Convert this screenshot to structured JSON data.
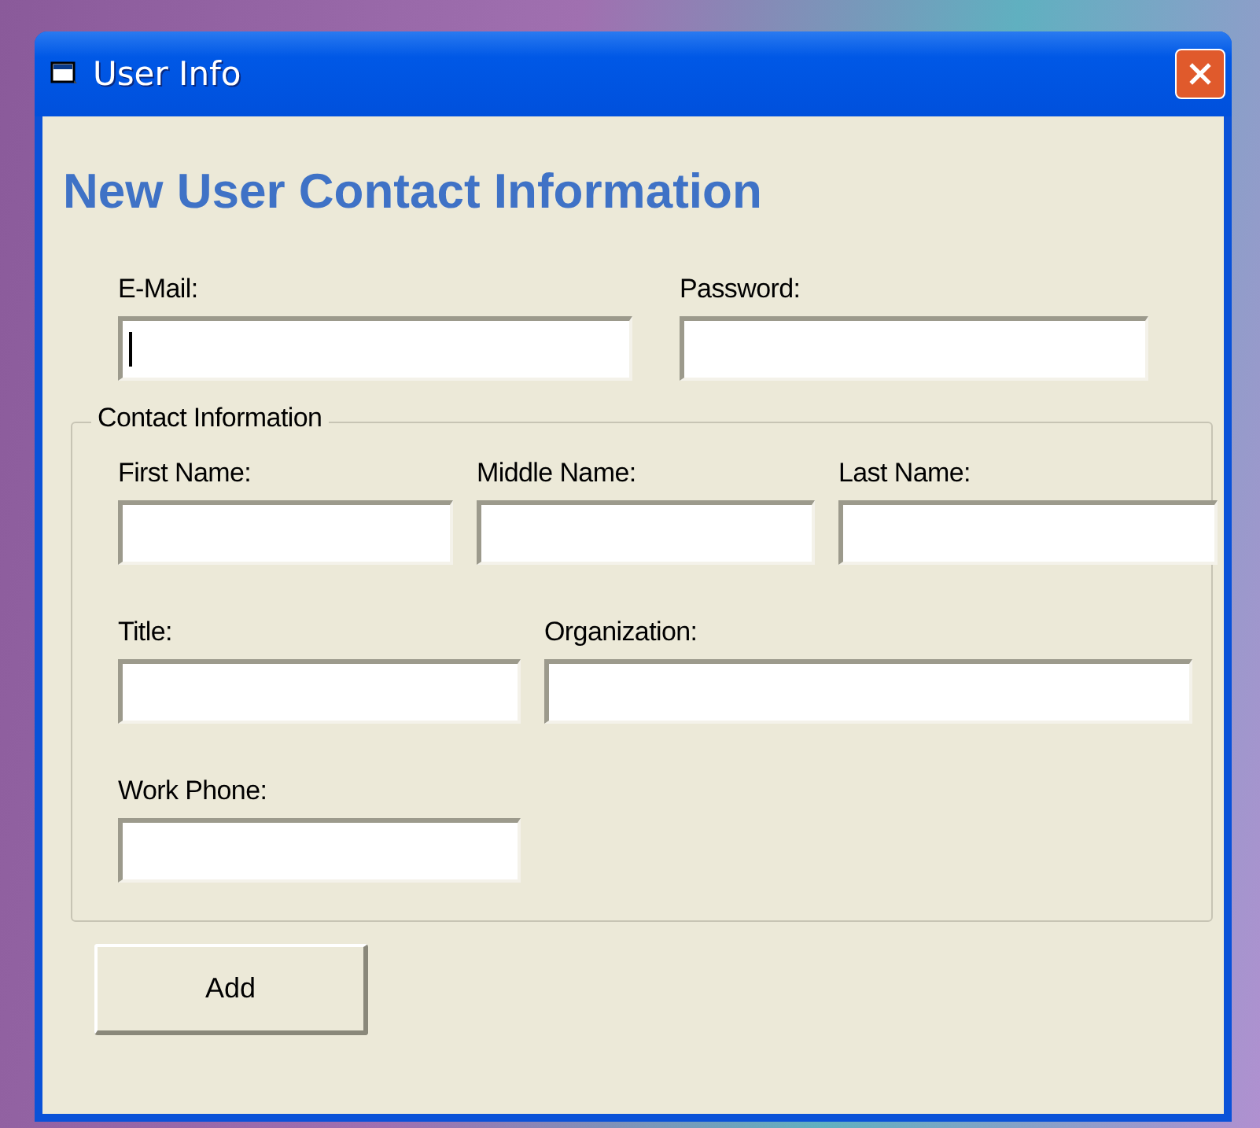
{
  "window": {
    "title": "User Info"
  },
  "heading": "New User Contact Information",
  "account_fields": [
    {
      "label": "E-Mail:",
      "focused": true
    },
    {
      "label": "Password:",
      "focused": false
    }
  ],
  "contact_information": {
    "title": "Contact Information",
    "rows": [
      [
        {
          "label": "First Name:",
          "focused": false
        },
        {
          "label": "Middle Name:",
          "focused": false
        },
        {
          "label": "Last Name:",
          "focused": false
        }
      ],
      [
        {
          "label": "Title:",
          "focused": false
        },
        {
          "label": "Organization:",
          "focused": false
        }
      ],
      [
        {
          "label": "Work Phone:",
          "focused": false
        }
      ]
    ]
  },
  "buttons": [
    "Add"
  ]
}
